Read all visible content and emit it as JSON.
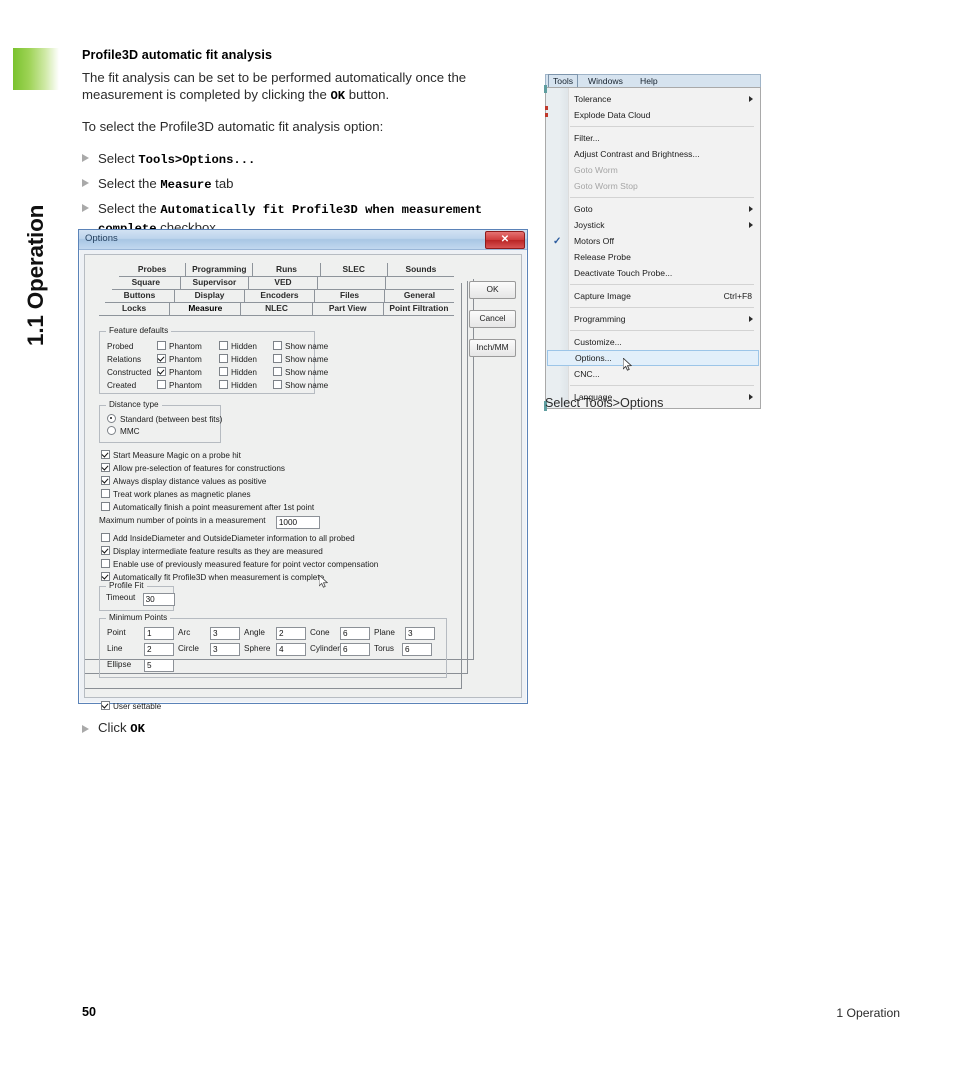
{
  "sidebar": {
    "chapter_label": "1.1 Operation",
    "accent_color": "#7ac22e"
  },
  "section": {
    "title": "Profile3D automatic fit analysis",
    "para1_a": "The fit analysis can be set to be performed automatically once the measurement is completed by clicking the ",
    "para1_ok": "OK",
    "para1_b": " button.",
    "para2": "To select the Profile3D automatic fit analysis option:",
    "steps": [
      {
        "pre": "Select ",
        "mono": "Tools>Options...",
        "post": ""
      },
      {
        "pre": "Select the ",
        "mono": "Measure",
        "post": " tab"
      },
      {
        "pre": "Select the ",
        "mono": "Automatically fit Profile3D when measurement complete",
        "post": " checkbox"
      }
    ],
    "click_pre": "Click ",
    "click_mono": "OK"
  },
  "dialog": {
    "title": "Options",
    "close_label": "✕",
    "buttons": [
      {
        "label": "OK"
      },
      {
        "label": "Cancel"
      },
      {
        "label": "Inch/MM"
      }
    ],
    "tab_rows": [
      [
        "Probes",
        "Programming",
        "Runs",
        "SLEC",
        "Sounds"
      ],
      [
        "Square",
        "Supervisor",
        "VED",
        "",
        ""
      ],
      [
        "Buttons",
        "Display",
        "Encoders",
        "Files",
        "General"
      ],
      [
        "Locks",
        "Measure",
        "NLEC",
        "Part View",
        "Point Filtration"
      ]
    ],
    "selected_tab": "Measure",
    "feature_defaults": {
      "legend": "Feature defaults",
      "columns": [
        "Phantom",
        "Hidden",
        "Show name"
      ],
      "rows": [
        {
          "name": "Probed",
          "phantom": false,
          "hidden": false,
          "show_name": false
        },
        {
          "name": "Relations",
          "phantom": true,
          "hidden": false,
          "show_name": false
        },
        {
          "name": "Constructed",
          "phantom": true,
          "hidden": false,
          "show_name": false
        },
        {
          "name": "Created",
          "phantom": false,
          "hidden": false,
          "show_name": false
        }
      ]
    },
    "distance_type": {
      "legend": "Distance type",
      "options": [
        {
          "label": "Standard (between best fits)",
          "selected": true
        },
        {
          "label": "MMC",
          "selected": false
        }
      ]
    },
    "checkboxes": [
      {
        "label": "Start Measure Magic on a probe hit",
        "checked": true
      },
      {
        "label": "Allow pre-selection of features for constructions",
        "checked": true
      },
      {
        "label": "Always display distance values as positive",
        "checked": true
      },
      {
        "label": "Treat work planes as magnetic planes",
        "checked": false
      },
      {
        "label": "Automatically finish a point measurement after 1st point",
        "checked": false
      }
    ],
    "max_points": {
      "label": "Maximum number of points in a measurement",
      "value": "1000"
    },
    "checkboxes2": [
      {
        "label": "Add InsideDiameter and OutsideDiameter information to all probed",
        "checked": false
      },
      {
        "label": "Display intermediate feature results as they are measured",
        "checked": true
      },
      {
        "label": "Enable use of previously measured feature for point vector compensation",
        "checked": false
      },
      {
        "label": "Automatically fit Profile3D when measurement is complete",
        "checked": true
      }
    ],
    "profile_fit": {
      "legend": "Profile Fit",
      "timeout_label": "Timeout",
      "timeout_value": "30"
    },
    "minimum_points": {
      "legend": "Minimum Points",
      "fields": [
        {
          "label": "Point",
          "value": "1"
        },
        {
          "label": "Arc",
          "value": "3"
        },
        {
          "label": "Angle",
          "value": "2"
        },
        {
          "label": "Cone",
          "value": "6"
        },
        {
          "label": "Plane",
          "value": "3"
        },
        {
          "label": "Line",
          "value": "2"
        },
        {
          "label": "Circle",
          "value": "3"
        },
        {
          "label": "Sphere",
          "value": "4"
        },
        {
          "label": "Cylinder",
          "value": "6"
        },
        {
          "label": "Torus",
          "value": "6"
        },
        {
          "label": "Ellipse",
          "value": "5"
        }
      ]
    },
    "user_settable": {
      "label": "User settable",
      "checked": true
    }
  },
  "tools_menu": {
    "menubar": [
      {
        "label": "Tools",
        "selected": true
      },
      {
        "label": "Windows",
        "selected": false
      },
      {
        "label": "Help",
        "selected": false
      }
    ],
    "items": [
      {
        "label": "Tolerance",
        "submenu": true
      },
      {
        "label": "Explode Data Cloud"
      },
      {
        "separator": true
      },
      {
        "label": "Filter..."
      },
      {
        "label": "Adjust Contrast and Brightness..."
      },
      {
        "label": "Goto Worm",
        "disabled": true
      },
      {
        "label": "Goto Worm Stop",
        "disabled": true
      },
      {
        "separator": true
      },
      {
        "label": "Goto",
        "submenu": true
      },
      {
        "label": "Joystick",
        "submenu": true
      },
      {
        "label": "Motors Off",
        "checked": true
      },
      {
        "label": "Release Probe"
      },
      {
        "label": "Deactivate Touch Probe..."
      },
      {
        "separator": true
      },
      {
        "label": "Capture Image",
        "accel": "Ctrl+F8"
      },
      {
        "separator": true
      },
      {
        "label": "Programming",
        "submenu": true
      },
      {
        "separator": true
      },
      {
        "label": "Customize..."
      },
      {
        "label": "Options...",
        "highlighted": true
      },
      {
        "label": "CNC..."
      },
      {
        "separator": true
      },
      {
        "label": "Language",
        "submenu": true
      }
    ],
    "caption": "Select Tools>Options"
  },
  "footer": {
    "page_number": "50",
    "chapter": "1 Operation"
  }
}
